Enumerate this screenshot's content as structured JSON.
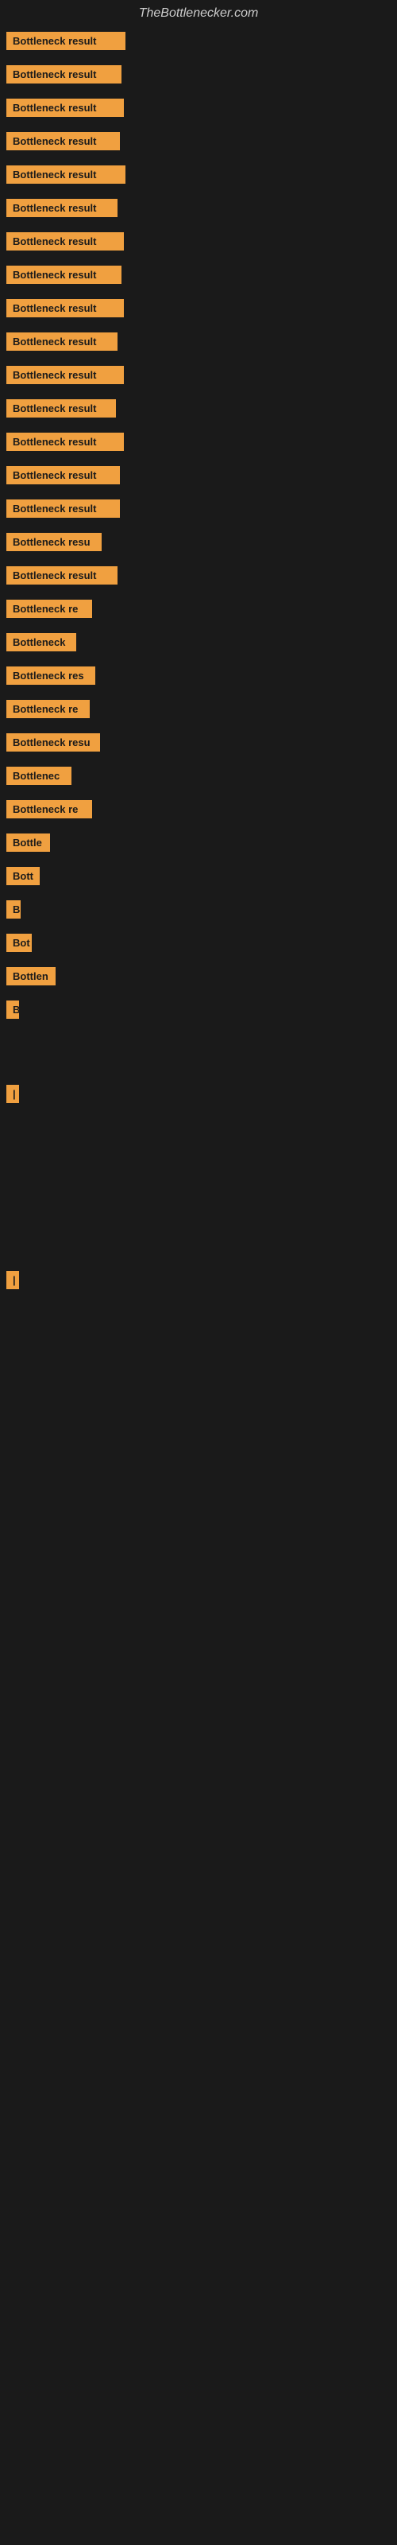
{
  "site": {
    "title": "TheBottlenecker.com"
  },
  "bars": [
    {
      "label": "Bottleneck result",
      "width": 150
    },
    {
      "label": "Bottleneck result",
      "width": 145
    },
    {
      "label": "Bottleneck result",
      "width": 148
    },
    {
      "label": "Bottleneck result",
      "width": 143
    },
    {
      "label": "Bottleneck result",
      "width": 150
    },
    {
      "label": "Bottleneck result",
      "width": 140
    },
    {
      "label": "Bottleneck result",
      "width": 148
    },
    {
      "label": "Bottleneck result",
      "width": 145
    },
    {
      "label": "Bottleneck result",
      "width": 148
    },
    {
      "label": "Bottleneck result",
      "width": 140
    },
    {
      "label": "Bottleneck result",
      "width": 148
    },
    {
      "label": "Bottleneck result",
      "width": 138
    },
    {
      "label": "Bottleneck result",
      "width": 148
    },
    {
      "label": "Bottleneck result",
      "width": 143
    },
    {
      "label": "Bottleneck result",
      "width": 143
    },
    {
      "label": "Bottleneck resu",
      "width": 120
    },
    {
      "label": "Bottleneck result",
      "width": 140
    },
    {
      "label": "Bottleneck re",
      "width": 108
    },
    {
      "label": "Bottleneck",
      "width": 88
    },
    {
      "label": "Bottleneck res",
      "width": 112
    },
    {
      "label": "Bottleneck re",
      "width": 105
    },
    {
      "label": "Bottleneck resu",
      "width": 118
    },
    {
      "label": "Bottlenec",
      "width": 82
    },
    {
      "label": "Bottleneck re",
      "width": 108
    },
    {
      "label": "Bottle",
      "width": 55
    },
    {
      "label": "Bott",
      "width": 42
    },
    {
      "label": "B",
      "width": 18
    },
    {
      "label": "Bot",
      "width": 32
    },
    {
      "label": "Bottlen",
      "width": 62
    },
    {
      "label": "B",
      "width": 16
    },
    {
      "label": "",
      "width": 0
    },
    {
      "label": "",
      "width": 0
    },
    {
      "label": "|",
      "width": 8
    },
    {
      "label": "",
      "width": 0
    },
    {
      "label": "",
      "width": 0
    },
    {
      "label": "",
      "width": 0
    },
    {
      "label": "",
      "width": 0
    },
    {
      "label": "",
      "width": 0
    },
    {
      "label": "",
      "width": 0
    },
    {
      "label": "|",
      "width": 8
    }
  ]
}
